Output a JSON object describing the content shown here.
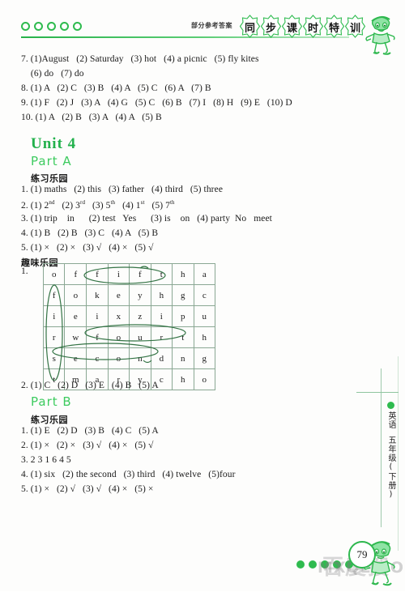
{
  "header": {
    "subtitle": "部分参考答案",
    "title_chars": [
      "同",
      "步",
      "课",
      "时",
      "特",
      "训"
    ],
    "dot_count": 5,
    "accent_color": "#2fbb4f"
  },
  "answers_top": [
    "7. (1)August   (2) Saturday   (3) hot   (4) a picnic   (5) fly kites",
    "    (6) do   (7) do",
    "8. (1) A   (2) C   (3) B   (4) A   (5) C   (6) A   (7) B",
    "9. (1) F   (2) J   (3) A   (4) G   (5) C   (6) B   (7) I   (8) H   (9) E   (10) D",
    "10. (1) A   (2) B   (3) A   (4) A   (5) B"
  ],
  "unit": {
    "title": "Unit 4",
    "part_a": {
      "label": "Part A",
      "section1_heading": "练习乐园",
      "section1_items": [
        "1. (1) maths   (2) this   (3) father   (4) third   (5) three",
        "3. (1) trip    in      (2) test   Yes      (3) is    on   (4) party  No   meet",
        "4. (1) B   (2) B   (3) C   (4) A   (5) B",
        "5. (1) ×   (2) ×   (3) √   (4) ×   (5) √"
      ],
      "ordinals_item": {
        "prefix": "2. (1) 2",
        "parts": [
          {
            "num": "2",
            "sup": "nd"
          },
          {
            "num": "3",
            "sup": "rd"
          },
          {
            "num": "5",
            "sup": "th"
          },
          {
            "num": "1",
            "sup": "st"
          },
          {
            "num": "7",
            "sup": "th"
          }
        ],
        "labels": [
          "2. (1)",
          "(2)",
          "(3)",
          "(4)",
          "(5)"
        ]
      },
      "section2_heading": "趣味乐园",
      "puzzle": {
        "number": "1.",
        "rows": [
          [
            "o",
            "f",
            "f",
            "i",
            "f",
            "t",
            "h",
            "a"
          ],
          [
            "f",
            "o",
            "k",
            "e",
            "y",
            "h",
            "g",
            "c"
          ],
          [
            "i",
            "e",
            "i",
            "x",
            "z",
            "i",
            "p",
            "u"
          ],
          [
            "r",
            "w",
            "f",
            "o",
            "u",
            "r",
            "t",
            "h"
          ],
          [
            "s",
            "e",
            "c",
            "o",
            "n",
            "d",
            "n",
            "g"
          ],
          [
            "t",
            "m",
            "a",
            "r",
            "y",
            "c",
            "h",
            "o"
          ]
        ],
        "circled_words": [
          "fifth",
          "first",
          "fourth",
          "second"
        ]
      },
      "section2_item2": "2. (1) C   (2) D   (3) E   (4) B   (5) A"
    },
    "part_b": {
      "label": "Part B",
      "heading": "练习乐园",
      "items": [
        "1. (1) E   (2) D   (3) B   (4) C   (5) A",
        "2. (1) ×   (2) ×   (3) √   (4) ×   (5) √",
        "3. 2 3 1 6 4 5",
        "4. (1) six   (2) the second   (3) third   (4) twelve   (5)four",
        "5. (1) ×   (2) √   (3) √   (4) ×   (5) ×"
      ]
    }
  },
  "side_tab": {
    "subject": "英语",
    "grade": "五年级",
    "volume": "(下册)"
  },
  "footer": {
    "page_number": "79",
    "dot_count": 6,
    "watermark": "MXQE.COM",
    "watermark_cn": "百度搜"
  }
}
